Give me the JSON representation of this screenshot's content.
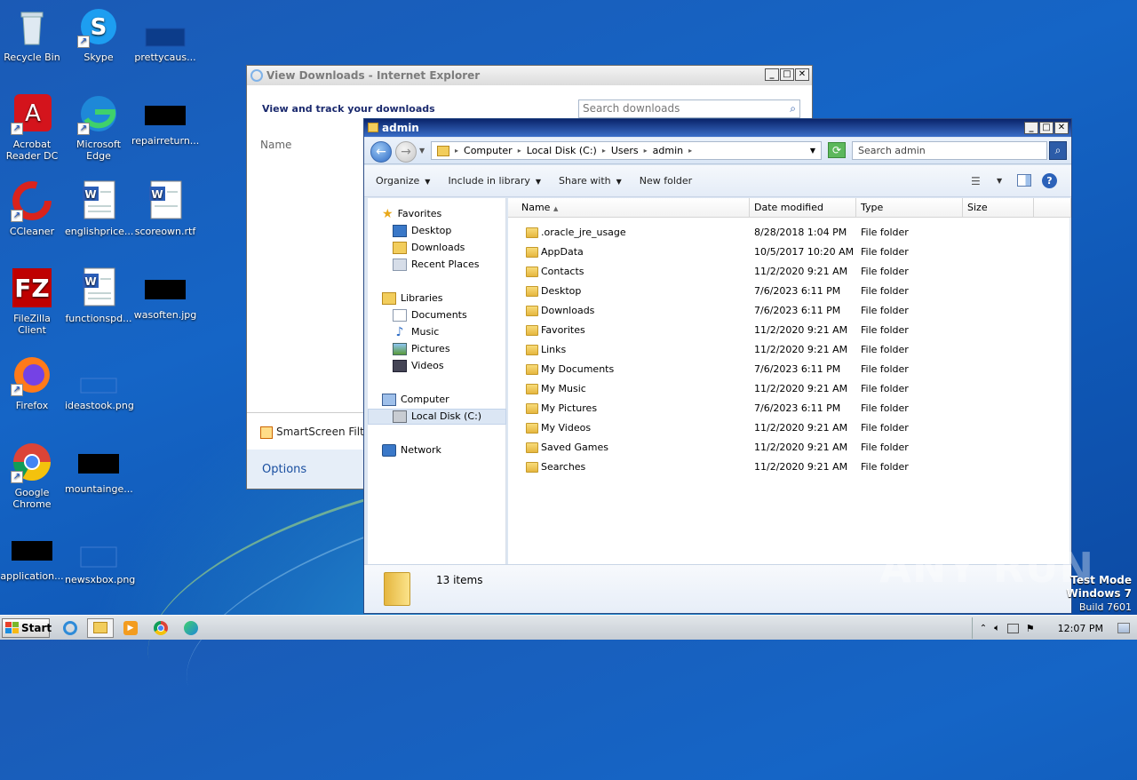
{
  "desktop": {
    "icons": [
      {
        "label": "Recycle Bin"
      },
      {
        "label": "Skype"
      },
      {
        "label": "prettycaus..."
      },
      {
        "label": "Acrobat Reader DC"
      },
      {
        "label": "Microsoft Edge"
      },
      {
        "label": "repairreturn..."
      },
      {
        "label": "CCleaner"
      },
      {
        "label": "englishprice..."
      },
      {
        "label": "scoreown.rtf"
      },
      {
        "label": "FileZilla Client"
      },
      {
        "label": "functionspd..."
      },
      {
        "label": "wasoften.jpg"
      },
      {
        "label": "Firefox"
      },
      {
        "label": "ideastook.png"
      },
      {
        "label": "Google Chrome"
      },
      {
        "label": "mountainge..."
      },
      {
        "label": "application..."
      },
      {
        "label": "newsxbox.png"
      }
    ]
  },
  "ie_window": {
    "title": "View Downloads - Internet Explorer",
    "heading": "View and track your downloads",
    "search_placeholder": "Search downloads",
    "column_name": "Name",
    "smartscreen": "SmartScreen Filte",
    "options": "Options"
  },
  "explorer": {
    "title": "admin",
    "breadcrumb": [
      "Computer",
      "Local Disk (C:)",
      "Users",
      "admin"
    ],
    "search_placeholder": "Search admin",
    "toolbar": {
      "organize": "Organize",
      "include_in_library": "Include in library",
      "share_with": "Share with",
      "new_folder": "New folder"
    },
    "nav": {
      "favorites": "Favorites",
      "desktop": "Desktop",
      "downloads": "Downloads",
      "recent_places": "Recent Places",
      "libraries": "Libraries",
      "documents": "Documents",
      "music": "Music",
      "pictures": "Pictures",
      "videos": "Videos",
      "computer": "Computer",
      "local_disk": "Local Disk (C:)",
      "network": "Network"
    },
    "columns": {
      "name": "Name",
      "date": "Date modified",
      "type": "Type",
      "size": "Size"
    },
    "files": [
      {
        "name": ".oracle_jre_usage",
        "date": "8/28/2018 1:04 PM",
        "type": "File folder"
      },
      {
        "name": "AppData",
        "date": "10/5/2017 10:20 AM",
        "type": "File folder"
      },
      {
        "name": "Contacts",
        "date": "11/2/2020 9:21 AM",
        "type": "File folder"
      },
      {
        "name": "Desktop",
        "date": "7/6/2023 6:11 PM",
        "type": "File folder"
      },
      {
        "name": "Downloads",
        "date": "7/6/2023 6:11 PM",
        "type": "File folder"
      },
      {
        "name": "Favorites",
        "date": "11/2/2020 9:21 AM",
        "type": "File folder"
      },
      {
        "name": "Links",
        "date": "11/2/2020 9:21 AM",
        "type": "File folder"
      },
      {
        "name": "My Documents",
        "date": "7/6/2023 6:11 PM",
        "type": "File folder"
      },
      {
        "name": "My Music",
        "date": "11/2/2020 9:21 AM",
        "type": "File folder"
      },
      {
        "name": "My Pictures",
        "date": "7/6/2023 6:11 PM",
        "type": "File folder"
      },
      {
        "name": "My Videos",
        "date": "11/2/2020 9:21 AM",
        "type": "File folder"
      },
      {
        "name": "Saved Games",
        "date": "11/2/2020 9:21 AM",
        "type": "File folder"
      },
      {
        "name": "Searches",
        "date": "11/2/2020 9:21 AM",
        "type": "File folder"
      }
    ],
    "item_count": "13 items"
  },
  "taskbar": {
    "start": "Start",
    "clock": "12:07 PM"
  },
  "watermark": "ANY RUN",
  "testmode": {
    "line1": "Test Mode",
    "line2": "Windows 7",
    "line3": "Build 7601"
  },
  "colors": {
    "accent": "#1565c6",
    "explorer_title": "#0a246a"
  }
}
